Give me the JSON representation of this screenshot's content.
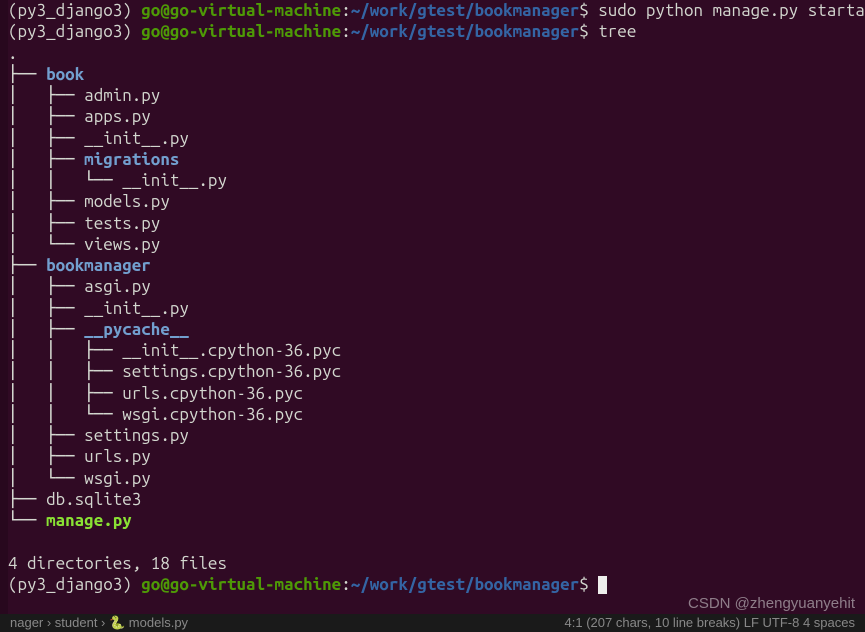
{
  "prompt1": {
    "env": "(py3_django3) ",
    "user_host": "go@go-virtual-machine",
    "sep": ":",
    "path": "~/work/gtest/bookmanager",
    "dollar": "$ ",
    "cmd": "sudo python manage.py startapp book"
  },
  "prompt2": {
    "env": "(py3_django3) ",
    "user_host": "go@go-virtual-machine",
    "sep": ":",
    "path": "~/work/gtest/bookmanager",
    "dollar": "$ ",
    "cmd": "tree"
  },
  "prompt3": {
    "env": "(py3_django3) ",
    "user_host": "go@go-virtual-machine",
    "sep": ":",
    "path": "~/work/gtest/bookmanager",
    "dollar": "$ "
  },
  "tree": {
    "root": ".",
    "lines": [
      {
        "prefix": "├── ",
        "name": "book",
        "type": "dir"
      },
      {
        "prefix": "│   ├── ",
        "name": "admin.py",
        "type": "file"
      },
      {
        "prefix": "│   ├── ",
        "name": "apps.py",
        "type": "file"
      },
      {
        "prefix": "│   ├── ",
        "name": "__init__.py",
        "type": "file"
      },
      {
        "prefix": "│   ├── ",
        "name": "migrations",
        "type": "dir"
      },
      {
        "prefix": "│   │   └── ",
        "name": "__init__.py",
        "type": "file"
      },
      {
        "prefix": "│   ├── ",
        "name": "models.py",
        "type": "file"
      },
      {
        "prefix": "│   ├── ",
        "name": "tests.py",
        "type": "file"
      },
      {
        "prefix": "│   └── ",
        "name": "views.py",
        "type": "file"
      },
      {
        "prefix": "├── ",
        "name": "bookmanager",
        "type": "dir"
      },
      {
        "prefix": "│   ├── ",
        "name": "asgi.py",
        "type": "file"
      },
      {
        "prefix": "│   ├── ",
        "name": "__init__.py",
        "type": "file"
      },
      {
        "prefix": "│   ├── ",
        "name": "__pycache__",
        "type": "dir"
      },
      {
        "prefix": "│   │   ├── ",
        "name": "__init__.cpython-36.pyc",
        "type": "file"
      },
      {
        "prefix": "│   │   ├── ",
        "name": "settings.cpython-36.pyc",
        "type": "file"
      },
      {
        "prefix": "│   │   ├── ",
        "name": "urls.cpython-36.pyc",
        "type": "file"
      },
      {
        "prefix": "│   │   └── ",
        "name": "wsgi.cpython-36.pyc",
        "type": "file"
      },
      {
        "prefix": "│   ├── ",
        "name": "settings.py",
        "type": "file"
      },
      {
        "prefix": "│   ├── ",
        "name": "urls.py",
        "type": "file"
      },
      {
        "prefix": "│   └── ",
        "name": "wsgi.py",
        "type": "file"
      },
      {
        "prefix": "├── ",
        "name": "db.sqlite3",
        "type": "file"
      },
      {
        "prefix": "└── ",
        "name": "manage.py",
        "type": "exec"
      }
    ],
    "summary": "4 directories, 18 files"
  },
  "watermark": "CSDN @zhengyuanyehit",
  "statusbar": {
    "left": "nager › student › 🐍 models.py",
    "right": "4:1 (207 chars, 10 line breaks)   LF   UTF-8   4 spaces"
  }
}
